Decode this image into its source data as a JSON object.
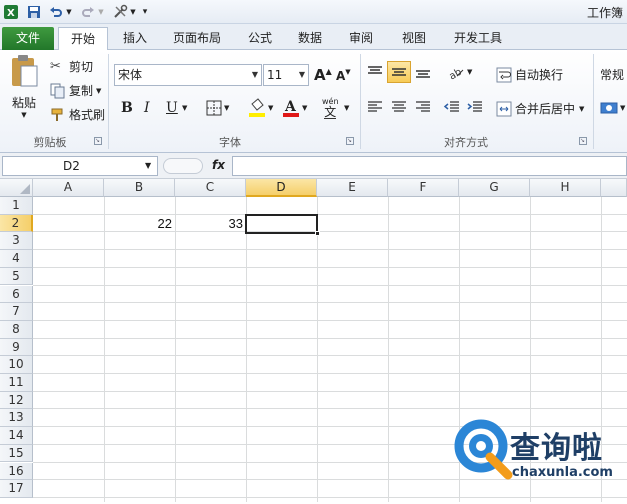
{
  "window": {
    "title": "工作簿"
  },
  "tabs": [
    "文件",
    "开始",
    "插入",
    "页面布局",
    "公式",
    "数据",
    "审阅",
    "视图",
    "开发工具"
  ],
  "ribbon": {
    "clipboard": {
      "paste": "粘贴",
      "cut": "剪切",
      "copy": "复制",
      "format_painter": "格式刷",
      "label": "剪贴板"
    },
    "font": {
      "name": "宋体",
      "size": "11",
      "grow": "A",
      "shrink": "A",
      "bold": "B",
      "italic": "I",
      "underline": "U",
      "label": "字体",
      "phonetic": "wén"
    },
    "alignment": {
      "wrap": "自动换行",
      "merge": "合并后居中",
      "label": "对齐方式"
    },
    "number": {
      "format": "常规"
    }
  },
  "formula_bar": {
    "name_box": "D2",
    "fx": "fx",
    "value": ""
  },
  "columns": [
    "A",
    "B",
    "C",
    "D",
    "E",
    "F",
    "G",
    "H"
  ],
  "rows": [
    "1",
    "2",
    "3",
    "4",
    "5",
    "6",
    "7",
    "8",
    "9",
    "10",
    "11",
    "12",
    "13",
    "14",
    "15",
    "16",
    "17"
  ],
  "cells": {
    "B2": "22",
    "C2": "33"
  },
  "selection": {
    "cell": "D2",
    "column": "D",
    "row": "2"
  },
  "watermark": {
    "brand": "查询啦",
    "site": "chaxunla.com"
  },
  "colors": {
    "file_tab": "#2a7d32",
    "selection_header": "#f5cf6a",
    "logo_blue": "#2b86d6",
    "logo_orange": "#f39c1a"
  }
}
